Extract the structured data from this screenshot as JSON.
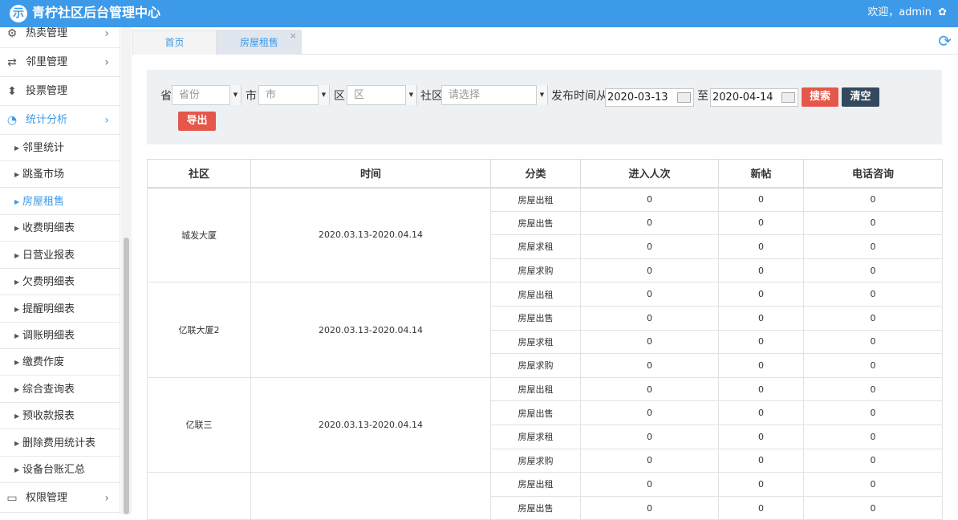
{
  "app": {
    "title": "青柠社区后台管理中心",
    "logo_char": "示",
    "welcome": "欢迎，admin",
    "gear": "✿"
  },
  "sidebar": {
    "items": [
      {
        "label": "热卖管理",
        "icon": "⚙",
        "chev": "›"
      },
      {
        "label": "邻里管理",
        "icon": "⇄",
        "chev": "›"
      },
      {
        "label": "投票管理",
        "icon": "⬍",
        "chev": ""
      },
      {
        "label": "统计分析",
        "icon": "◔",
        "chev": "›"
      },
      {
        "label": "权限管理",
        "icon": "▭",
        "chev": "›"
      }
    ],
    "sub_items": [
      "邻里统计",
      "跳蚤市场",
      "房屋租售",
      "收费明细表",
      "日营业报表",
      "欠费明细表",
      "提醒明细表",
      "调账明细表",
      "缴费作废",
      "综合查询表",
      "预收款报表",
      "删除费用统计表",
      "设备台账汇总"
    ]
  },
  "tabs": [
    {
      "label": "首页"
    },
    {
      "label": "房屋租售",
      "close": "×"
    }
  ],
  "refresh_icon": "⟳",
  "filter": {
    "province_label": "省",
    "province_placeholder": "省份",
    "city_label": "市",
    "city_placeholder": "市",
    "district_label": "区",
    "district_placeholder": "区",
    "community_label": "社区",
    "community_placeholder": "请选择",
    "date_label": "发布时间从",
    "date_from": "2020-03-13",
    "to_label": "至",
    "date_to": "2020-04-14",
    "search": "搜索",
    "clear": "清空",
    "export": "导出",
    "dropdown_glyph": "▼"
  },
  "table": {
    "headers": [
      "社区",
      "时间",
      "分类",
      "进入人次",
      "新帖",
      "电话咨询"
    ],
    "groups": [
      {
        "community": "城发大厦",
        "time": "2020.03.13-2020.04.14",
        "rows": [
          [
            "房屋出租",
            "0",
            "0",
            "0"
          ],
          [
            "房屋出售",
            "0",
            "0",
            "0"
          ],
          [
            "房屋求租",
            "0",
            "0",
            "0"
          ],
          [
            "房屋求购",
            "0",
            "0",
            "0"
          ]
        ]
      },
      {
        "community": "亿联大厦2",
        "time": "2020.03.13-2020.04.14",
        "rows": [
          [
            "房屋出租",
            "0",
            "0",
            "0"
          ],
          [
            "房屋出售",
            "0",
            "0",
            "0"
          ],
          [
            "房屋求租",
            "0",
            "0",
            "0"
          ],
          [
            "房屋求购",
            "0",
            "0",
            "0"
          ]
        ]
      },
      {
        "community": "亿联三",
        "time": "2020.03.13-2020.04.14",
        "rows": [
          [
            "房屋出租",
            "0",
            "0",
            "0"
          ],
          [
            "房屋出售",
            "0",
            "0",
            "0"
          ],
          [
            "房屋求租",
            "0",
            "0",
            "0"
          ],
          [
            "房屋求购",
            "0",
            "0",
            "0"
          ]
        ]
      },
      {
        "community": "",
        "time": "",
        "rows": [
          [
            "房屋出租",
            "0",
            "0",
            "0"
          ],
          [
            "房屋出售",
            "0",
            "0",
            "0"
          ]
        ]
      }
    ]
  }
}
